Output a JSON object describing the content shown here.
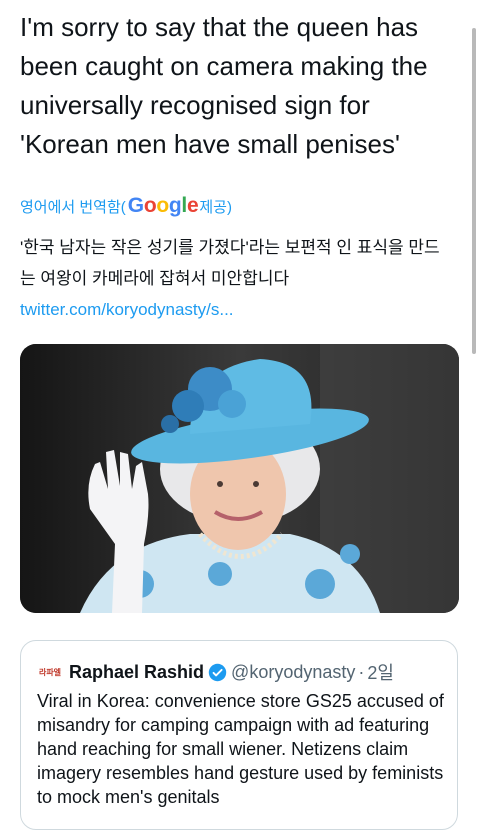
{
  "tweet": {
    "text": "I'm sorry to say that the queen has\nbeen caught on camera making the\nuniversally recognised sign for\n'Korean men have small penises'"
  },
  "translation": {
    "prefix": "영어에서 번역함(",
    "google_logo": "Google",
    "suffix": " 제공)",
    "logo_colors": [
      "#4285F4",
      "#EA4335",
      "#FBBC05",
      "#4285F4",
      "#34A853",
      "#EA4335"
    ],
    "text": "'한국 남자는 작은 성기를 가졌다'라는 보편적 인 표식을 만드는 여왕이 카메라에 잡혀서 미안합니다",
    "link": "twitter.com/koryodynasty/s..."
  },
  "media": {
    "icon": "photo-media"
  },
  "quoted_tweet": {
    "avatar_text": "라파엘",
    "name": "Raphael Rashid",
    "handle": "@koryodynasty",
    "separator": "·",
    "time": "2일",
    "text": "Viral in Korea: convenience store GS25 accused of misandry for camping campaign with ad featuring hand reaching for small wiener. Netizens claim imagery resembles hand gesture used by feminists to mock men's genitals"
  },
  "colors": {
    "link": "#1d9bf0",
    "text": "#0f1419",
    "secondary": "#536471",
    "border": "#cfd9de",
    "verified": "#1d9bf0"
  }
}
